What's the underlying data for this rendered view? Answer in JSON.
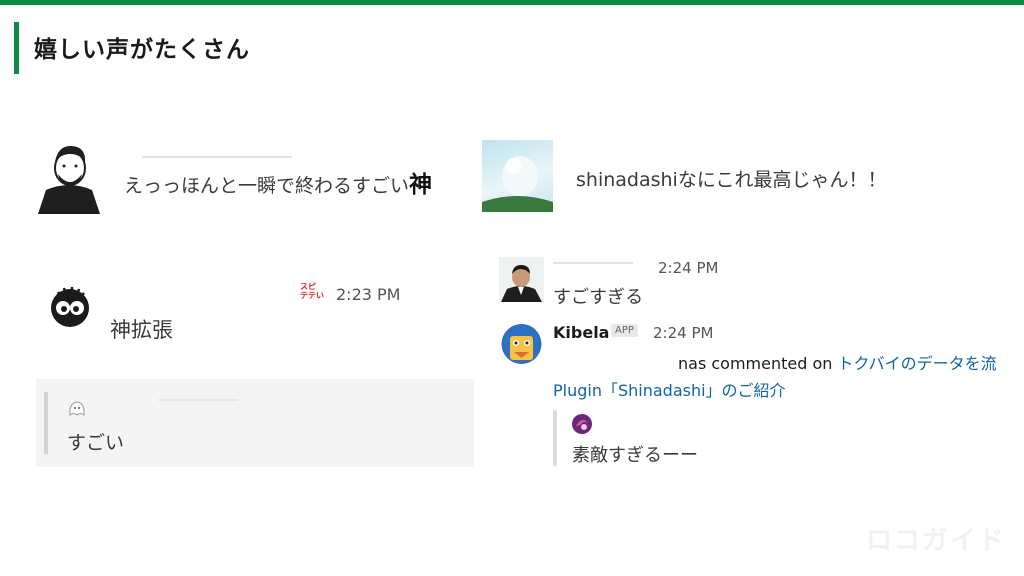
{
  "page": {
    "title": "嬉しい声がたくさん"
  },
  "post1": {
    "text": "えっっほんと一瞬で終わるすごい",
    "emphasis": "神"
  },
  "post2": {
    "text": "shinadashiなにこれ最高じゃん！！"
  },
  "post3": {
    "time": "2:23 PM",
    "text": "神拡張",
    "badge_line1": "スピ",
    "badge_line2": "テテい",
    "quote_text": "すごい"
  },
  "post4": {
    "time": "2:24 PM",
    "text": "すごすぎる"
  },
  "post5": {
    "sender": "Kibela",
    "badge": "APP",
    "time": "2:24 PM",
    "text_prefix": "nas commented on ",
    "link_line1": "トクバイのデータを流",
    "link_line2": "Plugin「Shinadashi」のご紹介",
    "quote_text": "素敵すぎるーー"
  },
  "watermark": "ロコガイド",
  "colors": {
    "accent": "#0f8a45",
    "link": "#1264a3"
  }
}
